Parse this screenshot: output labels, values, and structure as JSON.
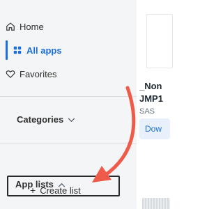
{
  "sidebar": {
    "nav": [
      {
        "label": "Home",
        "icon": "home-icon"
      },
      {
        "label": "All apps",
        "icon": "grid-icon",
        "active": true
      },
      {
        "label": "Favorites",
        "icon": "heart-icon"
      }
    ],
    "categories_label": "Categories",
    "app_lists_label": "App lists",
    "create_list_label": "Create list"
  },
  "content": {
    "title_line_1": "_Non",
    "title_line_2": "JMP1",
    "vendor": "SAS",
    "download_label": "Dow"
  },
  "colors": {
    "accent": "#1b6fd6",
    "annotation_arrow": "#ef5b4b"
  }
}
